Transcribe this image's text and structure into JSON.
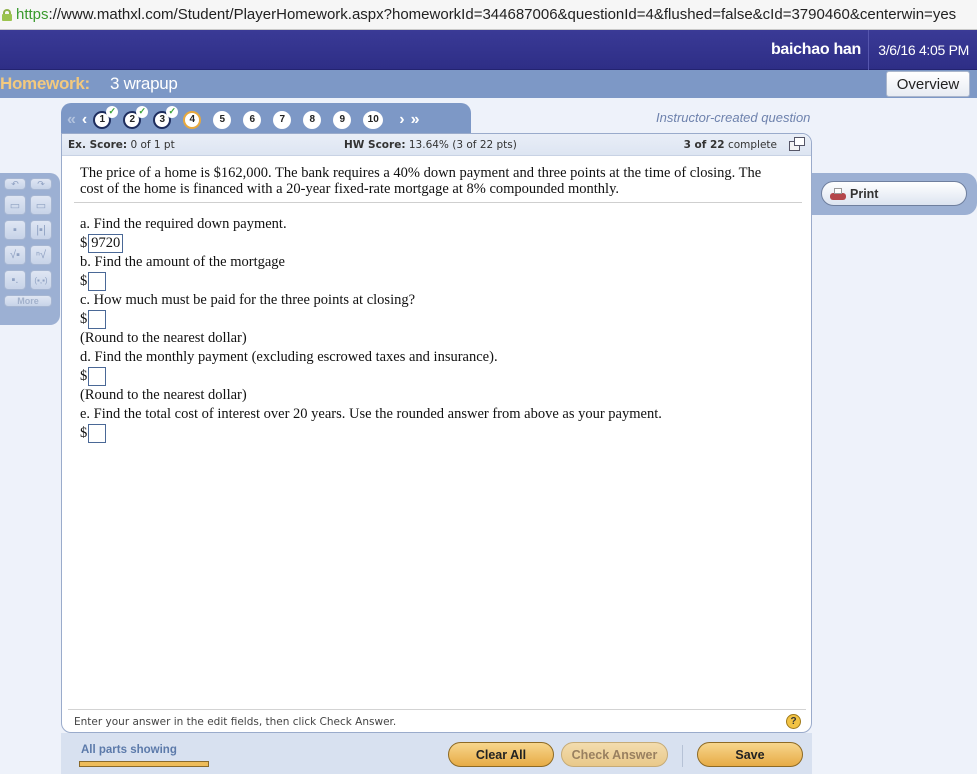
{
  "browser": {
    "url_scheme": "https",
    "url_rest": "://www.mathxl.com/Student/PlayerHomework.aspx?homeworkId=344687006&questionId=4&flushed=false&cId=3790460&centerwin=yes"
  },
  "header": {
    "user_name": "baichao han",
    "datetime": "3/6/16 4:05 PM"
  },
  "homework": {
    "label": "Homework:",
    "name": "3 wrapup",
    "overview_button": "Overview"
  },
  "question_nav": {
    "first_icon": "«",
    "prev_icon": "‹",
    "next_icon": "›",
    "last_icon": "»",
    "questions": [
      {
        "number": "1",
        "status": "done",
        "check": "✓"
      },
      {
        "number": "2",
        "status": "done",
        "check": "✓"
      },
      {
        "number": "3",
        "status": "done",
        "check": "✓"
      },
      {
        "number": "4",
        "status": "current"
      },
      {
        "number": "5",
        "status": "open"
      },
      {
        "number": "6",
        "status": "open"
      },
      {
        "number": "7",
        "status": "open"
      },
      {
        "number": "8",
        "status": "open"
      },
      {
        "number": "9",
        "status": "open"
      },
      {
        "number": "10",
        "status": "open"
      }
    ],
    "question_source": "Instructor-created question"
  },
  "scores": {
    "ex_label": "Ex. Score:",
    "ex_value": "0 of 1 pt",
    "hw_label": "HW Score:",
    "hw_value": "13.64% (3 of 22 pts)",
    "complete_bold": "3 of 22",
    "complete_text": "complete"
  },
  "question": {
    "stem_line1": "The price of a home is $162,000.  The bank requires a 40% down payment and three points at the time of closing.  The",
    "stem_line2": "cost of the home is financed with a 20-year fixed-rate mortgage at 8% compounded monthly.",
    "parts": {
      "a_prompt": "a. Find the required down payment.",
      "a_value": "9720",
      "b_prompt": "b. Find the amount of the mortgage",
      "b_value": "",
      "c_prompt": "c. How much must be paid for the three points at closing?",
      "c_value": "",
      "c_note": "(Round to the nearest dollar)",
      "d_prompt": "d. Find the monthly payment (excluding escrowed taxes and insurance).",
      "d_value": "",
      "d_note": "(Round to the nearest dollar)",
      "e_prompt": "e. Find the total cost of interest over 20 years. Use the rounded answer from  above as your payment.",
      "e_value": ""
    },
    "currency_symbol": "$"
  },
  "footer": {
    "instruction": "Enter your answer in the edit fields, then click Check Answer.",
    "help_icon": "?",
    "parts_showing": "All parts showing",
    "clear_all": "Clear All",
    "check_answer": "Check Answer",
    "save": "Save"
  },
  "tool_palette": {
    "undo": "↶",
    "redo": "↷",
    "fraction": "▭",
    "mixed": "▭",
    "exponent": "▪",
    "abs": "|▪|",
    "sqrt": "√▪",
    "nthroot": "ⁿ√",
    "subscript": "▪.",
    "ordered_pair": "(▪,▪)",
    "more": "More"
  },
  "print": {
    "label": "Print"
  }
}
